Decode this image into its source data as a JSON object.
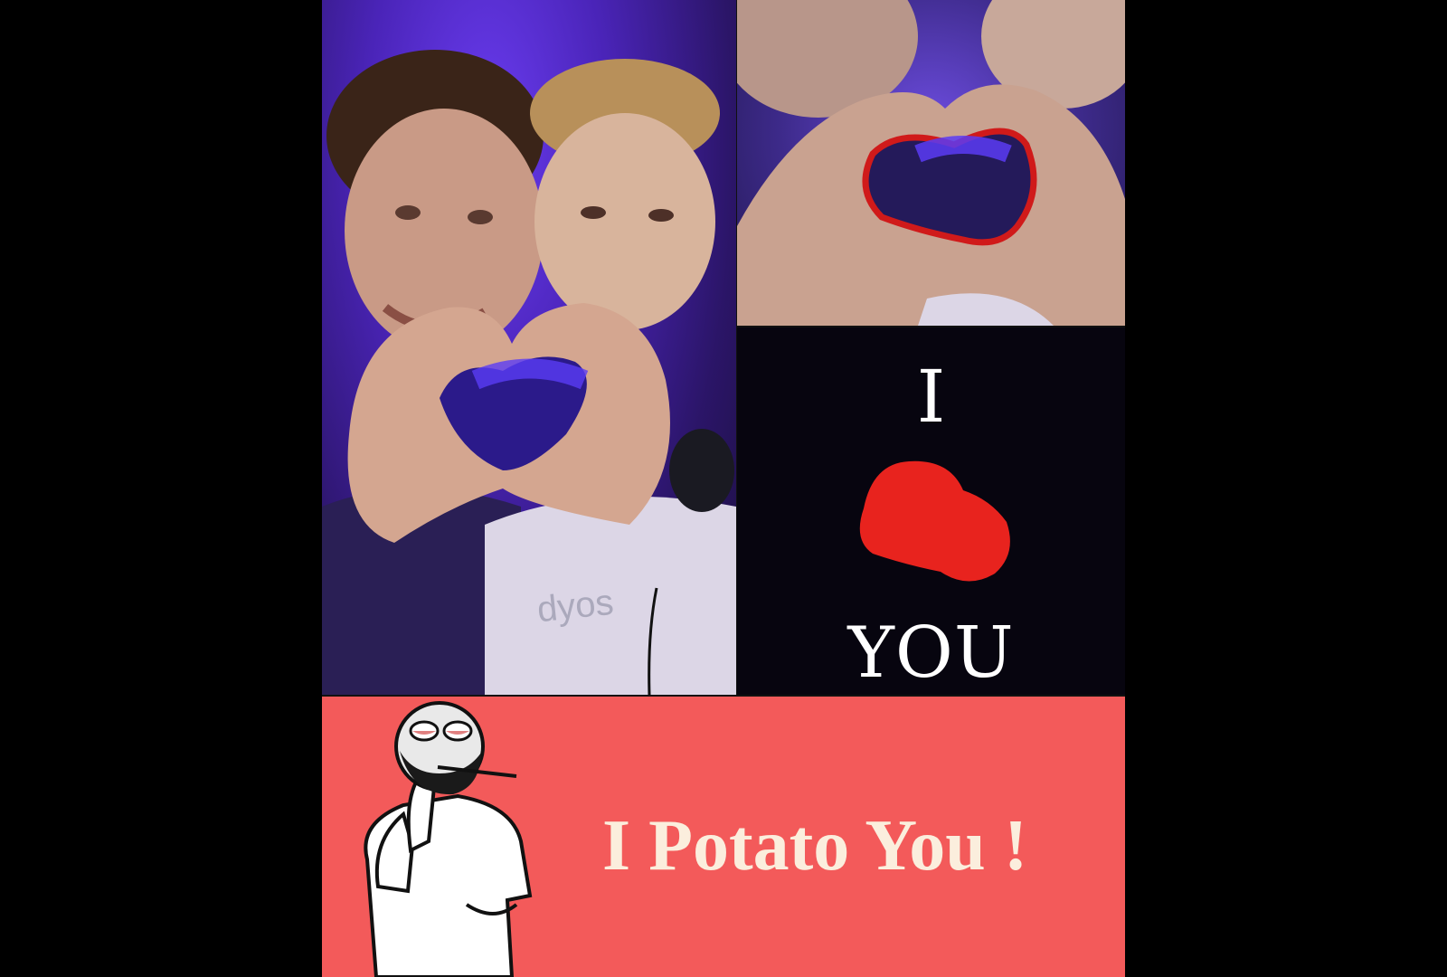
{
  "watermark": "dyos",
  "middle_panel": {
    "top_word": "I",
    "bottom_word": "YOU",
    "shape_color": "#e8231e"
  },
  "bottom_panel": {
    "caption": "I Potato You !",
    "background_color": "#f35a5a"
  }
}
